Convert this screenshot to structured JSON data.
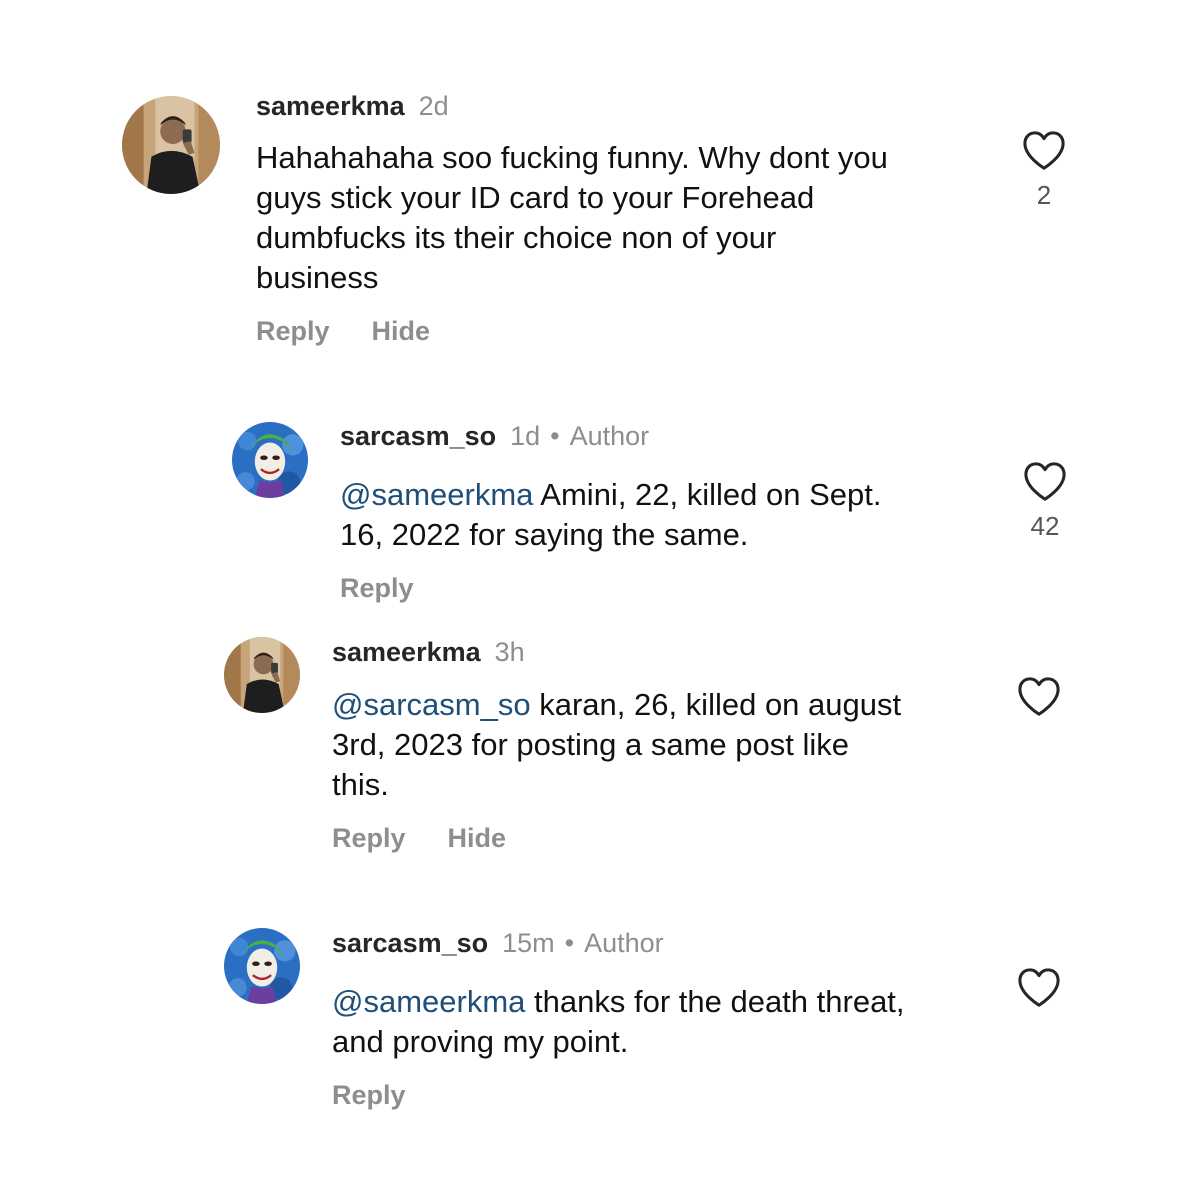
{
  "colors": {
    "mention": "#1f4e79",
    "muted": "#8e8e8e",
    "text": "#111111"
  },
  "comments": [
    {
      "username": "sameerkma",
      "time": "2d",
      "author": "",
      "mention": "",
      "text": "Hahahahaha soo fucking funny. Why dont you\nguys stick your ID card to your Forehead\ndumbfucks its their choice non of your\nbusiness",
      "reply_label": "Reply",
      "hide_label": "Hide",
      "likes": "2",
      "avatar": "man-photo-avatar"
    },
    {
      "username": "sarcasm_so",
      "time": "1d",
      "dot": "•",
      "author": "Author",
      "mention": "@sameerkma",
      "text": " Amini, 22, killed on Sept.\n16, 2022 for saying the same.",
      "reply_label": "Reply",
      "likes": "42",
      "avatar": "joker-avatar"
    },
    {
      "username": "sameerkma",
      "time": "3h",
      "author": "",
      "mention": "@sarcasm_so",
      "text": " karan, 26, killed on august\n3rd, 2023 for posting a same post like\nthis.",
      "reply_label": "Reply",
      "hide_label": "Hide",
      "likes": "",
      "avatar": "man-photo-avatar"
    },
    {
      "username": "sarcasm_so",
      "time": "15m",
      "dot": "•",
      "author": "Author",
      "mention": "@sameerkma",
      "text": " thanks for the death threat,\nand proving my point.",
      "reply_label": "Reply",
      "likes": "",
      "avatar": "joker-avatar"
    }
  ]
}
